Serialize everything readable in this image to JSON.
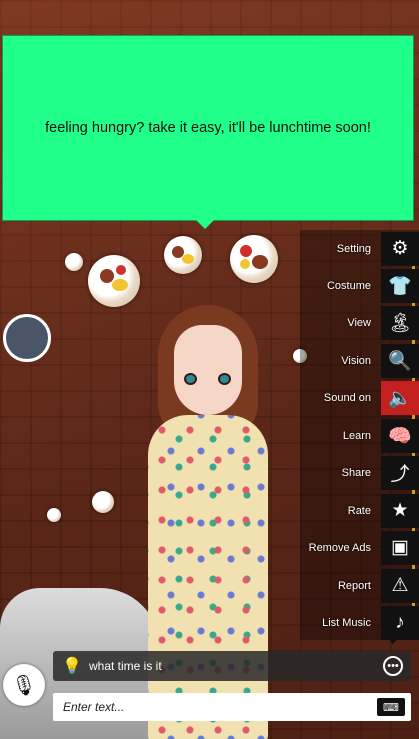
{
  "speech_bubble": {
    "text": "feeling hungry? take it easy, it'll be lunchtime soon!",
    "color": "#1fff8a"
  },
  "menu": {
    "items": [
      {
        "label": "Setting",
        "icon": "gear-icon",
        "glyph": "⚙",
        "active": false
      },
      {
        "label": "Costume",
        "icon": "shirt-icon",
        "glyph": "👕",
        "active": false
      },
      {
        "label": "View",
        "icon": "beach-view-icon",
        "glyph": "🏝",
        "active": false
      },
      {
        "label": "Vision",
        "icon": "zoom-out-icon",
        "glyph": "🔍",
        "active": false
      },
      {
        "label": "Sound on",
        "icon": "speaker-icon",
        "glyph": "🔈",
        "active": true
      },
      {
        "label": "Learn",
        "icon": "brain-head-icon",
        "glyph": "🧠",
        "active": false
      },
      {
        "label": "Share",
        "icon": "share-icon",
        "glyph": "⤴",
        "active": false
      },
      {
        "label": "Rate",
        "icon": "star-icon",
        "glyph": "★",
        "active": false
      },
      {
        "label": "Remove Ads",
        "icon": "no-ads-icon",
        "glyph": "▣",
        "active": false
      },
      {
        "label": "Report",
        "icon": "warning-icon",
        "glyph": "⚠",
        "active": false
      },
      {
        "label": "List Music",
        "icon": "music-note-icon",
        "glyph": "♪",
        "active": false
      }
    ],
    "active_color": "#c4201f"
  },
  "suggestion": {
    "text": "what time is it",
    "bulb_icon": "lightbulb-icon",
    "more_icon": "more-options-icon"
  },
  "input": {
    "placeholder": "Enter text...",
    "keyboard_icon": "keyboard-icon"
  },
  "voice": {
    "icon": "microphone-icon"
  }
}
